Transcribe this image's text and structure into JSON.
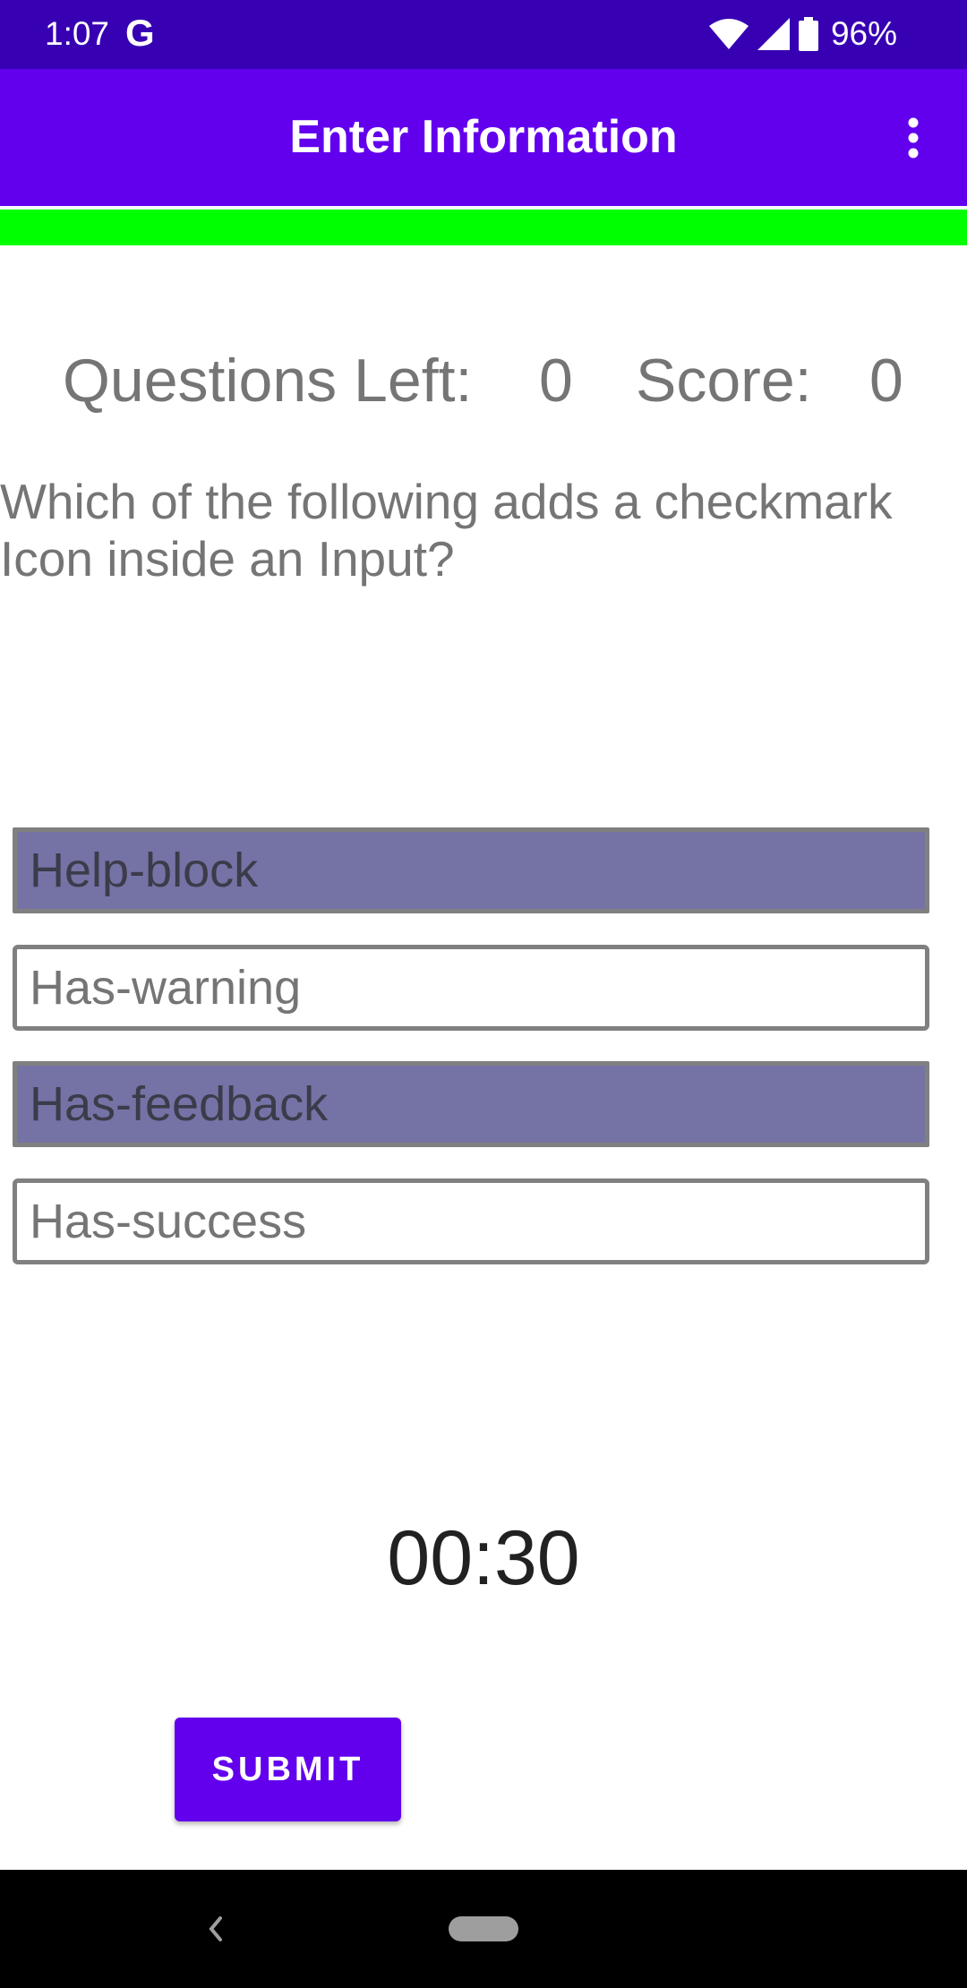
{
  "status_bar": {
    "time": "1:07",
    "google_glyph": "G",
    "battery": "96%",
    "icons": [
      "wifi-icon",
      "signal-icon",
      "battery-icon"
    ]
  },
  "app_bar": {
    "title": "Enter Information",
    "overflow_icon": "more-vert-icon",
    "background": "#6200ee"
  },
  "progress": {
    "value": 1.0,
    "color": "#00ff00"
  },
  "stats": {
    "questions_left_label": "Questions Left:",
    "questions_left_value": "0",
    "score_label": "Score:",
    "score_value": "0"
  },
  "question": {
    "text": "Which of the following adds a checkmark Icon inside an Input?"
  },
  "options": [
    {
      "label": "Help-block",
      "highlighted": true
    },
    {
      "label": "Has-warning",
      "highlighted": false
    },
    {
      "label": "Has-feedback",
      "highlighted": true
    },
    {
      "label": "Has-success",
      "highlighted": false
    }
  ],
  "timer": {
    "text": "00:30"
  },
  "submit": {
    "label": "SUBMIT"
  },
  "nav_bar": {
    "back_icon": "back-chevron-icon",
    "home_icon": "home-pill-icon"
  }
}
